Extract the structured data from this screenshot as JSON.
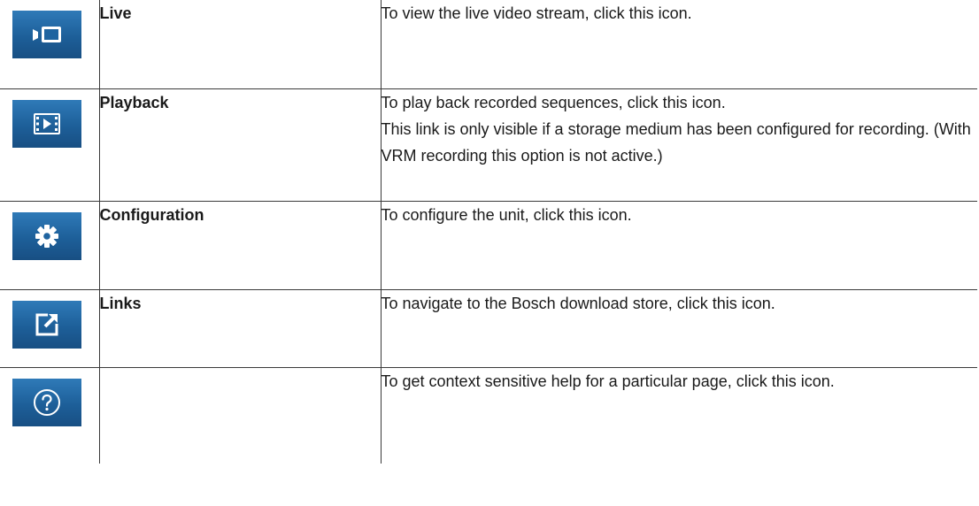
{
  "rows": [
    {
      "icon": "live-camera-icon",
      "name": "Live",
      "description": [
        "To view the live video stream, click this icon."
      ]
    },
    {
      "icon": "playback-film-icon",
      "name": "Playback",
      "description": [
        "To play back recorded sequences, click this icon.",
        "This link is only visible if a storage medium has been configured for recording. (With VRM recording this option is not active.)"
      ]
    },
    {
      "icon": "gear-icon",
      "name": "Configuration",
      "description": [
        "To configure the unit, click this icon."
      ]
    },
    {
      "icon": "external-link-icon",
      "name": "Links",
      "description": [
        "To navigate to the Bosch download store, click this icon."
      ]
    },
    {
      "icon": "help-question-icon",
      "name": "",
      "description": [
        "To get context sensitive help for a particular page, click this icon."
      ]
    }
  ],
  "colors": {
    "icon_tile": "#1d5f99",
    "icon_glyph": "#ffffff",
    "border": "#3a3a3a"
  }
}
